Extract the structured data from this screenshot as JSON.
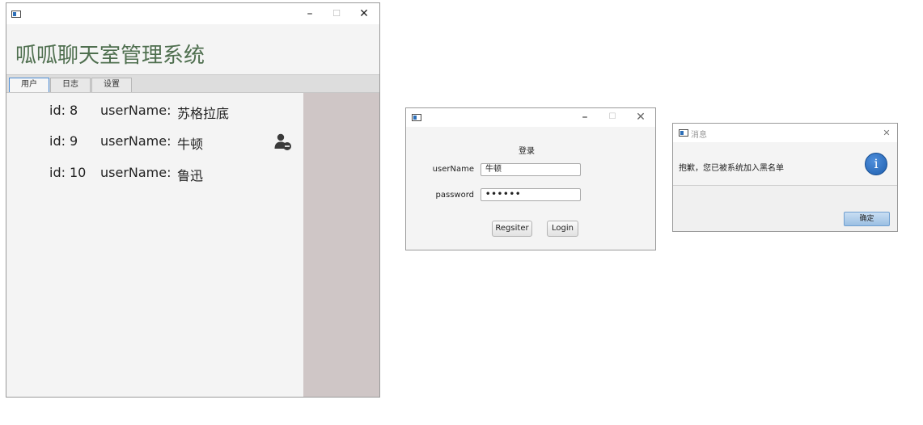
{
  "main_window": {
    "controls": {
      "minimize": "–",
      "maximize": "☐",
      "close": "✕"
    },
    "app_title": "呱呱聊天室管理系统",
    "tabs": [
      {
        "label": "用户",
        "active": true
      },
      {
        "label": "日志",
        "active": false
      },
      {
        "label": "设置",
        "active": false
      }
    ],
    "users": [
      {
        "id_label": "id:",
        "id": "8",
        "name_label": "userName:",
        "name": "苏格拉底"
      },
      {
        "id_label": "id:",
        "id": "9",
        "name_label": "userName:",
        "name": "牛顿"
      },
      {
        "id_label": "id:",
        "id": "10",
        "name_label": "userName:",
        "name": "鲁迅"
      }
    ],
    "remove_icon": "user-remove-icon"
  },
  "login_window": {
    "controls": {
      "minimize": "–",
      "maximize": "☐",
      "close": "✕"
    },
    "heading": "登录",
    "username_label": "userName",
    "username_value": "牛顿",
    "password_label": "password",
    "password_value": "••••••",
    "register_button": "Regsiter",
    "login_button": "Login"
  },
  "message_dialog": {
    "title": "消息",
    "close": "✕",
    "message": "抱歉，您已被系统加入黑名单",
    "info_icon_glyph": "i",
    "ok_button": "确定"
  },
  "colors": {
    "title_green": "#4f6f4f",
    "side_panel": "#cfc6c6",
    "tab_focus": "#4a8bd4",
    "info_blue": "#2a6cc0"
  }
}
